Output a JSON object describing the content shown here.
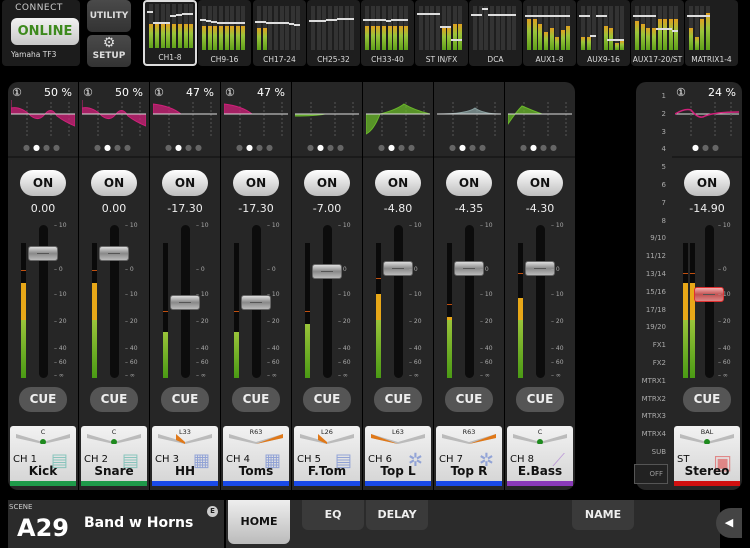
{
  "connect": {
    "label": "CONNECT",
    "status": "ONLINE",
    "model": "Yamaha TF3"
  },
  "utility_label": "UTILITY",
  "setup_label": "SETUP",
  "banks": [
    {
      "label": "CH1-8",
      "selected": true,
      "meters": [
        0.55,
        0.55,
        0.55,
        0.55,
        0.55,
        0.55,
        0.55,
        0.55
      ],
      "faders": [
        0.8,
        0.55,
        0.55,
        0.55,
        0.7,
        0.72,
        0.74,
        0.74
      ]
    },
    {
      "label": "CH9-16",
      "meters": [
        0.55,
        0.55,
        0.55,
        0.55,
        0.55,
        0.55,
        0.55,
        0.55
      ],
      "faders": [
        0.65,
        0.64,
        0.62,
        0.6,
        0.58,
        0.6,
        0.6,
        0.6
      ]
    },
    {
      "label": "CH17-24",
      "meters": [
        0.5,
        0.5,
        0,
        0,
        0,
        0,
        0,
        0
      ],
      "faders": [
        0.62,
        0.62,
        0.6,
        0.6,
        0.6,
        0.58,
        0.56,
        0.55
      ]
    },
    {
      "label": "CH25-32",
      "meters": [
        0,
        0,
        0,
        0,
        0,
        0,
        0,
        0
      ],
      "faders": [
        0.64,
        0.64,
        0.64,
        0.66,
        0.66,
        0.68,
        0.68,
        0.68
      ]
    },
    {
      "label": "CH33-40",
      "meters": [
        0.55,
        0.55,
        0.55,
        0.55,
        0.55,
        0.55,
        0.55,
        0.55
      ],
      "faders": [
        0.66,
        0.65,
        0.65,
        0.66,
        0.64,
        0.66,
        0.66,
        0.66
      ]
    },
    {
      "label": "ST IN/FX",
      "meters": [
        0,
        0,
        0,
        0,
        0.5,
        0.5,
        0.6,
        0.6
      ],
      "faders": [
        0.8,
        0.8,
        0.8,
        0.8,
        0.5,
        0.5,
        0.2,
        0.2
      ]
    },
    {
      "label": "DCA",
      "meters": [],
      "faders": [
        0.78,
        0.78,
        0.9,
        0.78,
        0.78,
        0.78,
        0.78,
        0.78
      ]
    },
    {
      "label": "AUX1-8",
      "meters": [
        0.7,
        0.7,
        0.6,
        0.4,
        0.5,
        0.3,
        0.45,
        0.55
      ],
      "faders": [
        0.75,
        0.75,
        0.75,
        0.75,
        0.75,
        0.75,
        0.75,
        0.75
      ]
    },
    {
      "label": "AUX9-16",
      "meters": [
        0.3,
        0.3,
        0,
        0,
        0.55,
        0.5,
        0.15,
        0.2
      ],
      "faders": [
        0.75,
        0.75,
        0.3,
        0.75,
        0.75,
        0.2,
        0.2,
        0.2
      ]
    },
    {
      "label": "AUX17-20/ST",
      "meters": [
        0.65,
        0.6,
        0.5,
        0.5,
        0.7,
        0.7,
        0.7,
        0.7
      ],
      "faders": [
        0.75,
        0.75,
        0.75,
        0.75,
        0.45,
        0.45,
        0.45,
        0.4
      ]
    },
    {
      "label": "MATRIX1-4",
      "meters": [
        0.5,
        0.3,
        0.7,
        0.85
      ],
      "faders": [
        0.75,
        0.75,
        0.75,
        0.75
      ]
    }
  ],
  "channels": [
    {
      "num": "①",
      "pct": "50 %",
      "on": "ON",
      "level": "0.00",
      "fader": 0.82,
      "meter": 0.62,
      "peak": 0.62,
      "cue": "CUE",
      "pan": "C",
      "pan_type": "center",
      "ch": "CH 1",
      "name": "Kick",
      "icon": "drum-icon",
      "color": "#1e9a4a",
      "eq_color": "#d0207a",
      "eq": "wave"
    },
    {
      "num": "①",
      "pct": "50 %",
      "on": "ON",
      "level": "0.00",
      "fader": 0.82,
      "meter": 0.62,
      "peak": 0.62,
      "cue": "CUE",
      "pan": "C",
      "pan_type": "center",
      "ch": "CH 2",
      "name": "Snare",
      "icon": "drum-icon",
      "color": "#1e9a4a",
      "eq_color": "#d0207a",
      "eq": "wave"
    },
    {
      "num": "①",
      "pct": "47 %",
      "on": "ON",
      "level": "-17.30",
      "fader": 0.5,
      "meter": 0.3,
      "peak": 0.35,
      "cue": "CUE",
      "pan": "L33",
      "pan_type": "left-small",
      "ch": "CH 3",
      "name": "HH",
      "icon": "drums-icon",
      "color": "#1a4ae8",
      "eq_color": "#d0207a",
      "eq": "shelf"
    },
    {
      "num": "①",
      "pct": "47 %",
      "on": "ON",
      "level": "-17.30",
      "fader": 0.5,
      "meter": 0.3,
      "peak": 0.35,
      "cue": "CUE",
      "pan": "R63",
      "pan_type": "right-big",
      "ch": "CH 4",
      "name": "Toms",
      "icon": "drums-icon",
      "color": "#1a4ae8",
      "eq_color": "#d0207a",
      "eq": "shelf"
    },
    {
      "num": "",
      "pct": "",
      "on": "ON",
      "level": "-7.00",
      "fader": 0.7,
      "meter": 0.35,
      "peak": 0.35,
      "cue": "CUE",
      "pan": "L26",
      "pan_type": "left-small",
      "ch": "CH 5",
      "name": "F.Tom",
      "icon": "drum-icon",
      "color": "#1a4ae8",
      "eq_color": "#6ab82a",
      "eq": "flat"
    },
    {
      "num": "",
      "pct": "",
      "on": "ON",
      "level": "-4.80",
      "fader": 0.72,
      "meter": 0.55,
      "peak": 0.57,
      "cue": "CUE",
      "pan": "L63",
      "pan_type": "left-big",
      "ch": "CH 6",
      "name": "Top L",
      "icon": "drumkit-icon",
      "color": "#1a4ae8",
      "eq_color": "#6ab82a",
      "eq": "bell"
    },
    {
      "num": "",
      "pct": "",
      "on": "ON",
      "level": "-4.35",
      "fader": 0.72,
      "meter": 0.4,
      "peak": 0.4,
      "cue": "CUE",
      "pan": "R63",
      "pan_type": "right-big",
      "ch": "CH 7",
      "name": "Top R",
      "icon": "drumkit-icon",
      "color": "#1a4ae8",
      "eq_color": "#8aa0a0",
      "eq": "softbell"
    },
    {
      "num": "",
      "pct": "",
      "on": "ON",
      "level": "-4.30",
      "fader": 0.72,
      "meter": 0.52,
      "peak": 0.6,
      "cue": "CUE",
      "pan": "C",
      "pan_type": "center",
      "ch": "CH 8",
      "name": "E.Bass",
      "icon": "guitar-icon",
      "color": "#8a3ab8",
      "eq_color": "#6ab82a",
      "eq": "lowbell"
    }
  ],
  "scale": [
    "10",
    "0",
    "10",
    "20",
    "40",
    "60",
    "∞"
  ],
  "sends": [
    "1",
    "2",
    "3",
    "4",
    "5",
    "6",
    "7",
    "8",
    "9/10",
    "11/12",
    "13/14",
    "15/16",
    "17/18",
    "19/20",
    "FX1",
    "FX2",
    "MTRX1",
    "MTRX2",
    "MTRX3",
    "MTRX4",
    "SUB"
  ],
  "sends_off": "OFF",
  "stereo": {
    "num": "①",
    "pct": "24 %",
    "on": "ON",
    "level": "-14.90",
    "fader": 0.55,
    "meter": 0.62,
    "cue": "CUE",
    "pan": "BAL",
    "ch": "ST",
    "name": "Stereo",
    "color": "#d01010"
  },
  "scene": {
    "label": "SCENE",
    "number": "A29",
    "name": "Band w Horns",
    "edit": "E"
  },
  "toolbar": {
    "home": "HOME",
    "eq": "EQ",
    "delay": "DELAY",
    "name": "NAME",
    "collapse": "◀"
  }
}
